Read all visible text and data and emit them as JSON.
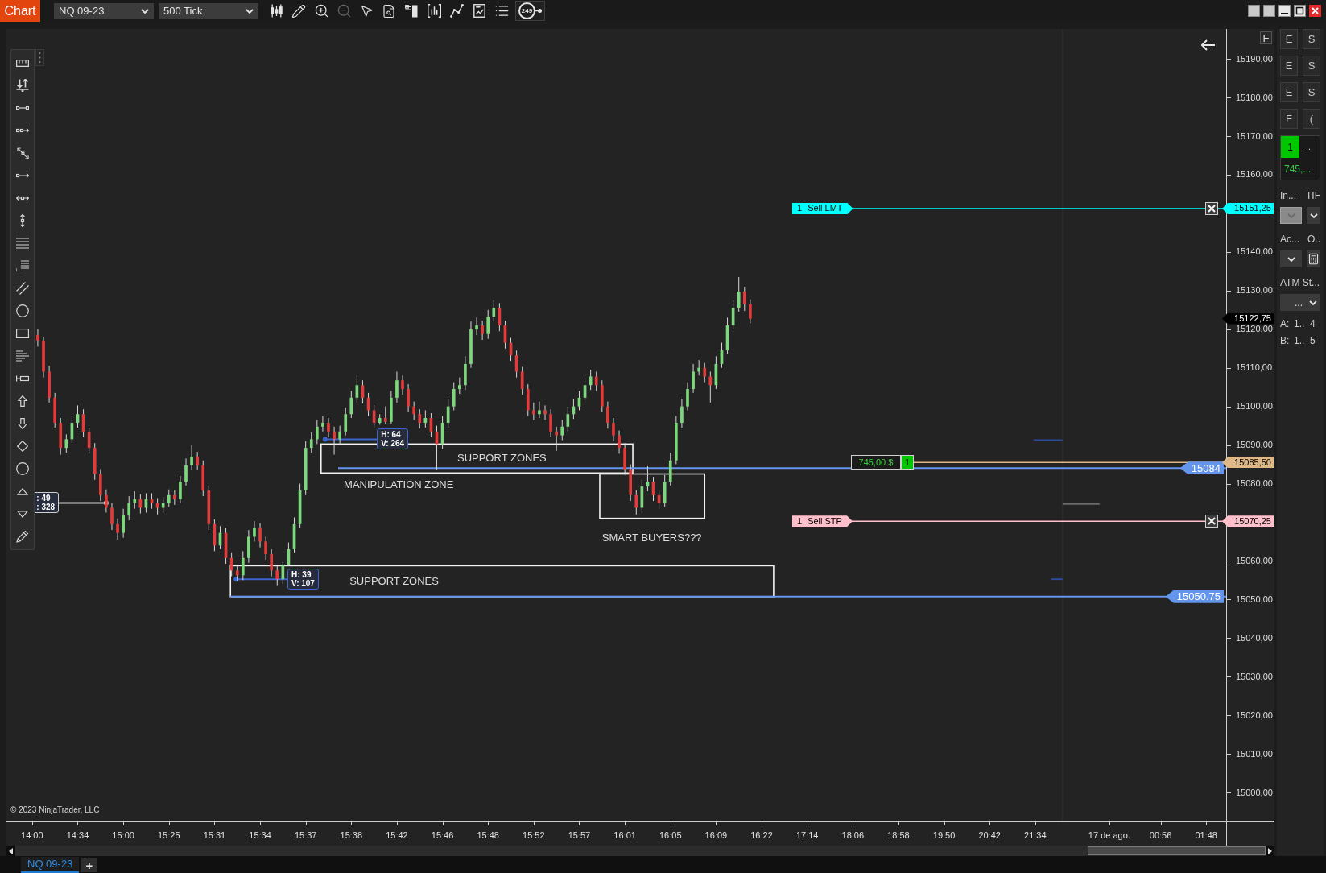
{
  "window": {
    "tab": "Chart",
    "instrument": "NQ 09-23",
    "interval": "500 Tick"
  },
  "toolbar": [
    {
      "disabled": false
    },
    {
      "disabled": false
    },
    {
      "disabled": false
    },
    {
      "disabled": true
    },
    {
      "disabled": false
    },
    {
      "disabled": false
    },
    {
      "disabled": false
    },
    {
      "disabled": false
    },
    {
      "disabled": false
    },
    {
      "disabled": false
    },
    {
      "disabled": false
    }
  ],
  "bar_counter": "249",
  "chart": {
    "axis_button": "F",
    "copyright": "© 2023 NinjaTrader, LLC",
    "last_price": "15122,75",
    "line_tags": [
      {
        "kind": "order",
        "quantity": "1",
        "type": "Sell LMT"
      },
      {
        "kind": "position",
        "pnl": "745,00 $",
        "quantity": "1"
      },
      {
        "kind": "drawn"
      },
      {
        "kind": "order",
        "quantity": "1",
        "type": "Sell STP"
      },
      {
        "kind": "drawn"
      }
    ],
    "drawings": [
      {
        "kind": "zone",
        "label": "SUPPORT ZONES"
      },
      {
        "kind": "zone"
      },
      {
        "kind": "zone",
        "label": "SUPPORT ZONES"
      },
      {
        "kind": "note",
        "text": "MANIPULATION ZONE"
      },
      {
        "kind": "note",
        "text": "SMART BUYERS???"
      }
    ],
    "measures": [
      {
        "lines": [
          ": 49",
          ": 328"
        ],
        "color": "#d0d0d0"
      },
      {
        "lines": [
          "H: 64",
          "V: 264"
        ],
        "color": "#3d63d0"
      },
      {
        "lines": [
          "H: 39",
          "V: 107"
        ],
        "color": "#3d63d0"
      }
    ],
    "chart_data": [
      {
        "type": "candlestick",
        "categories": [
          null,
          null,
          null,
          null,
          "14:00",
          null,
          null,
          null,
          null,
          null,
          null,
          null,
          "14:34",
          null,
          null,
          null,
          null,
          null,
          null,
          null,
          "15:00",
          null,
          null,
          null,
          null,
          null,
          null,
          null,
          "15:25",
          null,
          null,
          null,
          null,
          null,
          null,
          null,
          "15:31",
          null,
          null,
          null,
          null,
          null,
          null,
          null,
          "15:34",
          null,
          null,
          null,
          null,
          null,
          null,
          null,
          "15:37",
          null,
          null,
          null,
          null,
          null,
          null,
          null,
          "15:38",
          null,
          null,
          null,
          null,
          null,
          null,
          null,
          "15:42",
          null,
          null,
          null,
          null,
          null,
          null,
          null,
          "15:46",
          null,
          null,
          null,
          null,
          null,
          null,
          null,
          "15:48",
          null,
          null,
          null,
          null,
          null,
          null,
          null,
          "15:52",
          null,
          null,
          null,
          null,
          null,
          null,
          null,
          "15:57",
          null,
          null,
          null,
          null,
          null,
          null,
          null,
          "16:01",
          null,
          null,
          null,
          null,
          null,
          null,
          null,
          "16:05",
          null,
          null,
          null,
          null,
          null,
          null,
          null,
          "16:09",
          null,
          null,
          null,
          null,
          null,
          null,
          null,
          "16:22",
          null,
          null,
          null,
          null,
          null,
          null,
          null,
          "17:14",
          null,
          null,
          null,
          null,
          null,
          null,
          null,
          "18:06",
          null,
          null,
          null,
          null,
          null,
          null,
          null,
          "18:58",
          null,
          null,
          null,
          null,
          null,
          null,
          null,
          "19:50",
          null,
          null,
          null,
          null,
          null,
          null,
          null,
          "20:42",
          null,
          null,
          null,
          null,
          null,
          null,
          null,
          "21:34",
          null,
          null,
          null,
          null,
          null,
          null,
          null,
          null,
          null,
          null,
          null,
          null,
          "17 de ago.",
          null,
          null,
          null,
          null,
          null,
          null,
          null,
          null,
          "00:56",
          null,
          null,
          null,
          null,
          null,
          null,
          null,
          "01:48",
          null,
          null,
          null
        ],
        "ohlc": [
          null,
          null,
          null,
          null,
          null,
          [
            15118.5,
            15120,
            15115.5,
            15117
          ],
          [
            15117,
            15118,
            15107.5,
            15109
          ],
          [
            15109,
            15110.5,
            15101,
            15102.25
          ],
          [
            15102.25,
            15103.5,
            15094.5,
            15095.75
          ],
          [
            15095.75,
            15097,
            15087.5,
            15089.25
          ],
          [
            15089.25,
            15092.75,
            15088,
            15091.5
          ],
          [
            15091.5,
            15097,
            15090.5,
            15095.75
          ],
          [
            15095.75,
            15100.25,
            15094.5,
            15098
          ],
          [
            15098,
            15099.25,
            15092,
            15093.5
          ],
          [
            15093.5,
            15094.5,
            15087.75,
            15089.25
          ],
          [
            15089.25,
            15090.5,
            15081,
            15082.5
          ],
          [
            15082.5,
            15083.75,
            15075.5,
            15077
          ],
          [
            15077,
            15078.5,
            15072.5,
            15073.75
          ],
          [
            15073.75,
            15075,
            15068,
            15069.5
          ],
          [
            15069.5,
            15071,
            15065.5,
            15067.25
          ],
          [
            15067.25,
            15073.5,
            15066,
            15071.75
          ],
          [
            15071.75,
            15076.75,
            15070.5,
            15075
          ],
          [
            15075,
            15078,
            15073.5,
            15076
          ],
          [
            15076,
            15077.25,
            15072.25,
            15073.75
          ],
          [
            15073.75,
            15077.5,
            15072.5,
            15076
          ],
          [
            15076,
            15077.5,
            15073.5,
            15075
          ],
          [
            15075,
            15076.25,
            15072,
            15073.75
          ],
          [
            15073.75,
            15076.5,
            15072.5,
            15075
          ],
          [
            15075,
            15078.5,
            15074,
            15077
          ],
          [
            15077,
            15078.25,
            15074.5,
            15076
          ],
          [
            15076,
            15082,
            15075,
            15080.5
          ],
          [
            15080.5,
            15086.5,
            15079.5,
            15084.75
          ],
          [
            15084.75,
            15090,
            15083.5,
            15087
          ],
          [
            15087,
            15088.25,
            15083.5,
            15084.75
          ],
          [
            15084.75,
            15086,
            15076.75,
            15078.25
          ],
          [
            15078.25,
            15079.5,
            15068,
            15069.5
          ],
          [
            15069.5,
            15070.75,
            15062.5,
            15064
          ],
          [
            15064,
            15069,
            15063,
            15067.25
          ],
          [
            15067.25,
            15068.5,
            15059.25,
            15060.75
          ],
          [
            15060.75,
            15062,
            15056,
            15057.5
          ],
          [
            15057.5,
            15059,
            15054.75,
            15056.25
          ],
          [
            15056.25,
            15062.5,
            15055,
            15060.75
          ],
          [
            15060.75,
            15068,
            15059.5,
            15066.25
          ],
          [
            15066.25,
            15070.25,
            15065,
            15068.5
          ],
          [
            15068.5,
            15069.75,
            15063.5,
            15065
          ],
          [
            15065,
            15066.25,
            15060.25,
            15061.75
          ],
          [
            15061.75,
            15063,
            15056,
            15057.5
          ],
          [
            15057.5,
            15058.75,
            15053.5,
            15055.25
          ],
          [
            15055.25,
            15059.75,
            15054,
            15059
          ],
          [
            15059,
            15064.75,
            15058.75,
            15063
          ],
          [
            15063,
            15071.25,
            15062,
            15069.5
          ],
          [
            15069.5,
            15080,
            15068.5,
            15078.25
          ],
          [
            15078.25,
            15091,
            15077,
            15089.25
          ],
          [
            15089.25,
            15093.25,
            15088,
            15091.5
          ],
          [
            15091.5,
            15096.5,
            15090.25,
            15094.75
          ],
          [
            15094.75,
            15097.5,
            15093.5,
            15095.75
          ],
          [
            15095.75,
            15097,
            15092,
            15093.5
          ],
          [
            15093.5,
            15094.75,
            15087.5,
            15091.5
          ],
          [
            15091.5,
            15095,
            15090,
            15093.5
          ],
          [
            15093.5,
            15099.75,
            15092.5,
            15098
          ],
          [
            15098,
            15104,
            15097,
            15102.25
          ],
          [
            15102.25,
            15108,
            15101,
            15105.5
          ],
          [
            15105.5,
            15106.75,
            15100.75,
            15102.25
          ],
          [
            15102.25,
            15103.5,
            15097.5,
            15099
          ],
          [
            15099,
            15100.25,
            15094.25,
            15095.75
          ],
          [
            15095.75,
            15098,
            15095.25,
            15097
          ],
          [
            15097,
            15100,
            15095.5,
            15096
          ],
          [
            15096,
            15104,
            15095.5,
            15102.25
          ],
          [
            15102.25,
            15109,
            15101,
            15106.75
          ],
          [
            15106.75,
            15108,
            15103,
            15104.5
          ],
          [
            15104.5,
            15105.75,
            15098.5,
            15100
          ],
          [
            15100,
            15101.25,
            15096.5,
            15098
          ],
          [
            15098,
            15099.25,
            15094.25,
            15095.75
          ],
          [
            15095.75,
            15099,
            15094.5,
            15097
          ],
          [
            15097,
            15098.25,
            15092,
            15093.5
          ],
          [
            15093.5,
            15095,
            15083.5,
            15090.25
          ],
          [
            15090.25,
            15097.5,
            15089,
            15095.75
          ],
          [
            15095.75,
            15102,
            15094.5,
            15100
          ],
          [
            15100,
            15106.25,
            15099,
            15104.5
          ],
          [
            15104.5,
            15107.5,
            15103.25,
            15105.5
          ],
          [
            15105.5,
            15113,
            15104.25,
            15111
          ],
          [
            15111,
            15122,
            15110,
            15120
          ],
          [
            15120,
            15123,
            15118.5,
            15121
          ],
          [
            15121,
            15122.25,
            15117.25,
            15118.75
          ],
          [
            15118.75,
            15125,
            15117.5,
            15123.25
          ],
          [
            15123.25,
            15127.5,
            15122,
            15125.5
          ],
          [
            15125.5,
            15126.75,
            15119.5,
            15121
          ],
          [
            15121,
            15122.25,
            15115,
            15116.5
          ],
          [
            15116.5,
            15117.75,
            15111.75,
            15113.25
          ],
          [
            15113.25,
            15114.5,
            15107.5,
            15109
          ],
          [
            15109,
            15110.25,
            15103,
            15104.5
          ],
          [
            15104.5,
            15105.75,
            15097.5,
            15099
          ],
          [
            15099,
            15101,
            15096.5,
            15098
          ],
          [
            15098,
            15101.25,
            15097,
            15099
          ],
          [
            15099,
            15100.25,
            15096.5,
            15098
          ],
          [
            15098,
            15099.25,
            15092,
            15093.5
          ],
          [
            15093.5,
            15094.75,
            15088.5,
            15092.5
          ],
          [
            15092.5,
            15096.5,
            15091.25,
            15094.75
          ],
          [
            15094.75,
            15100,
            15093.5,
            15098
          ],
          [
            15098,
            15102,
            15096.75,
            15100
          ],
          [
            15100,
            15104,
            15099,
            15102.25
          ],
          [
            15102.25,
            15107.5,
            15101,
            15105.5
          ],
          [
            15105.5,
            15109.5,
            15104.25,
            15107.75
          ],
          [
            15107.75,
            15109,
            15104,
            15105.5
          ],
          [
            15105.5,
            15106.75,
            15098.5,
            15100
          ],
          [
            15100,
            15101.25,
            15094.25,
            15095.75
          ],
          [
            15095.75,
            15097,
            15091,
            15092.5
          ],
          [
            15092.5,
            15093.75,
            15087.75,
            15089.25
          ],
          [
            15089.25,
            15090.5,
            15082.25,
            15083.75
          ],
          [
            15083.75,
            15085,
            15075.5,
            15077
          ],
          [
            15077,
            15078.25,
            15072,
            15073.75
          ],
          [
            15073.75,
            15081,
            15072.5,
            15079.25
          ],
          [
            15079.25,
            15084.5,
            15078,
            15080.5
          ],
          [
            15080.5,
            15081.75,
            15075.5,
            15077
          ],
          [
            15077,
            15078.25,
            15073.5,
            15075
          ],
          [
            15075,
            15082.25,
            15074,
            15080.5
          ],
          [
            15080.5,
            15088,
            15079.5,
            15086
          ],
          [
            15086,
            15097.5,
            15085,
            15095.75
          ],
          [
            15095.75,
            15102,
            15094.5,
            15100
          ],
          [
            15100,
            15106.25,
            15099,
            15104.5
          ],
          [
            15104.5,
            15111,
            15103.5,
            15109
          ],
          [
            15109,
            15112,
            15108,
            15110
          ],
          [
            15110,
            15111.25,
            15106.25,
            15107.75
          ],
          [
            15107.75,
            15109,
            15101,
            15105.5
          ],
          [
            15105.5,
            15113,
            15104.5,
            15111
          ],
          [
            15111,
            15116.5,
            15110,
            15114.5
          ],
          [
            15114.5,
            15123,
            15113.5,
            15121
          ],
          [
            15121,
            15127.5,
            15120,
            15125.5
          ],
          [
            15125.5,
            15133.5,
            15124.5,
            15129.75
          ],
          [
            15129.75,
            15131,
            15124.75,
            15126.5
          ],
          [
            15126.5,
            15127.75,
            15121.5,
            15122.75
          ],
          null,
          null,
          null,
          null,
          null,
          null,
          null,
          null,
          null,
          null,
          null,
          null,
          null,
          null,
          null,
          null,
          null,
          null,
          null,
          null,
          null,
          null,
          null,
          null,
          null,
          null,
          null,
          null,
          null,
          null,
          null,
          null,
          null,
          null,
          null,
          null,
          null,
          null,
          null,
          null,
          null,
          null,
          null,
          null,
          null,
          null,
          null,
          null,
          null,
          null,
          null,
          null,
          null,
          null,
          null,
          null,
          null,
          null,
          null,
          null,
          null,
          null,
          null,
          null,
          null,
          null,
          null,
          null,
          null,
          null,
          null,
          null,
          null,
          null,
          null,
          null,
          null,
          null,
          null,
          null,
          null,
          null,
          null
        ],
        "ylim": [
          14992.5,
          15197.75
        ],
        "yticks": [
          {
            "value": 15190,
            "label": "15190,00"
          },
          {
            "value": 15180,
            "label": "15180,00"
          },
          {
            "value": 15170,
            "label": "15170,00"
          },
          {
            "value": 15160,
            "label": "15160,00"
          },
          {
            "value": 15140,
            "label": "15140,00"
          },
          {
            "value": 15130,
            "label": "15130,00"
          },
          {
            "value": 15120,
            "label": "15120,00"
          },
          {
            "value": 15110,
            "label": "15110,00"
          },
          {
            "value": 15100,
            "label": "15100,00"
          },
          {
            "value": 15090,
            "label": "15090,00"
          },
          {
            "value": 15080,
            "label": "15080,00"
          },
          {
            "value": 15060,
            "label": "15060,00"
          },
          {
            "value": 15050,
            "label": "15050,00"
          },
          {
            "value": 15040,
            "label": "15040,00"
          },
          {
            "value": 15030,
            "label": "15030,00"
          },
          {
            "value": 15020,
            "label": "15020,00"
          },
          {
            "value": 15010,
            "label": "15010,00"
          },
          {
            "value": 15000,
            "label": "15000,00"
          }
        ],
        "ref_lines": [
          {
            "axis": "y",
            "value": 15151.25,
            "label": "15151,25",
            "color": "#00ffff"
          },
          {
            "axis": "y",
            "value": 15085.5,
            "label": "15085,50",
            "color": "#deb887"
          },
          {
            "axis": "y",
            "value": 15084,
            "label": "15084",
            "color": "#6495ed"
          },
          {
            "axis": "y",
            "value": 15070.25,
            "label": "15070,25",
            "color": "#ffc0cb"
          },
          {
            "axis": "y",
            "value": 15050.75,
            "label": "15050.75",
            "color": "#6495ed"
          }
        ]
      }
    ]
  },
  "order_panel": {
    "buttons": [
      "E",
      "S",
      "E",
      "S",
      "E",
      "S",
      "F",
      "("
    ],
    "position": {
      "quantity": "1",
      "menu": "...",
      "pnl": "745,..."
    },
    "rows": [
      {
        "labels": [
          "In...",
          "TIF"
        ],
        "controls": [
          {
            "kind": "select",
            "disabled": true
          },
          {
            "kind": "select",
            "disabled": false
          }
        ]
      },
      {
        "labels": [
          "Ac...",
          "O.."
        ],
        "controls": [
          {
            "kind": "select",
            "disabled": false
          },
          {
            "kind": "calculator",
            "disabled": false
          }
        ]
      },
      {
        "labels": [
          "ATM St..."
        ],
        "controls": [
          {
            "kind": "select",
            "value": "...",
            "disabled": false
          }
        ]
      }
    ],
    "accounts": [
      {
        "label": "A:",
        "value": "1..",
        "count": "4"
      },
      {
        "label": "B:",
        "value": "1..",
        "count": "5"
      }
    ]
  },
  "tabs": [
    {
      "label": "NQ 09-23",
      "selected": true
    }
  ],
  "add_tab": "+"
}
